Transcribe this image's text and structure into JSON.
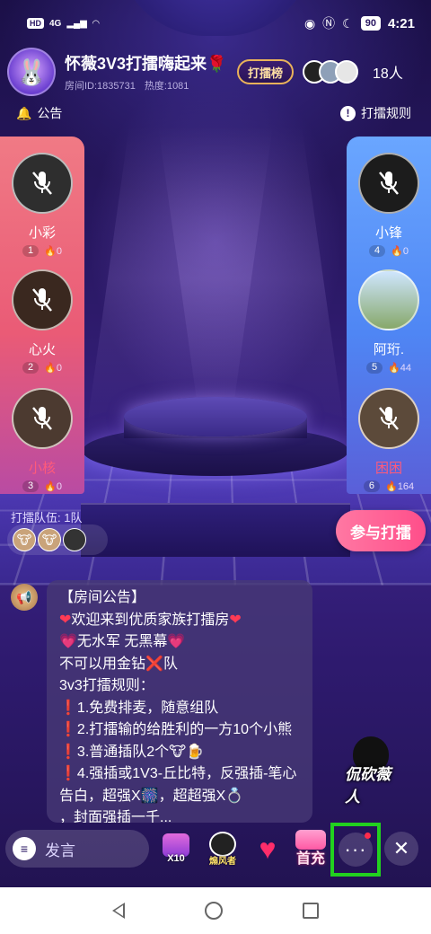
{
  "status_bar": {
    "left_badges": [
      "HD",
      "4G"
    ],
    "battery": "90",
    "time": "4:21"
  },
  "room": {
    "title": "怀薇3V3打擂嗨起来",
    "title_emoji": "🌹",
    "room_id": "房间ID:1835731",
    "heat": "热度:1081",
    "rank_label": "打擂榜",
    "audience_count": "18人"
  },
  "top_actions": {
    "notice": "公告",
    "rules": "打擂规则"
  },
  "left_team": [
    {
      "name": "小彩",
      "seat": "1",
      "score": "0"
    },
    {
      "name": "心火",
      "seat": "2",
      "score": "0"
    },
    {
      "name": "小核",
      "seat": "3",
      "score": "0"
    }
  ],
  "right_team": [
    {
      "name": "小锋",
      "seat": "4",
      "score": "0"
    },
    {
      "name": "阿珩.",
      "seat": "5",
      "score": "44"
    },
    {
      "name": "困困",
      "seat": "6",
      "score": "164"
    }
  ],
  "queue": {
    "label": "打擂队伍: 1队",
    "join_label": "参与打擂"
  },
  "chat": {
    "lines": [
      "【房间公告】",
      "欢迎来到优质家族打擂房",
      "无水军 无黑幕",
      "不可以用金钻",
      "队",
      "3v3打擂规则：",
      "1.免费排麦，随意组队",
      "2.打擂输的给胜利的一方10个小熊",
      "3.普通插队2个",
      "4.强插或1V3-丘比特，反强插-笔心告白，超强X",
      "，超超强X",
      "，封面强插一千..."
    ]
  },
  "sticker_text": "侃砍薇人",
  "toolbar": {
    "say_placeholder": "发言",
    "gift_label": "X10",
    "ninja_label": "煽风者",
    "recharge_label": "首充"
  },
  "colors": {
    "left_panel": "#ea5b76",
    "right_panel": "#4f86f4",
    "join_button": "#ff4e8a",
    "highlight_box": "#22d11f"
  }
}
